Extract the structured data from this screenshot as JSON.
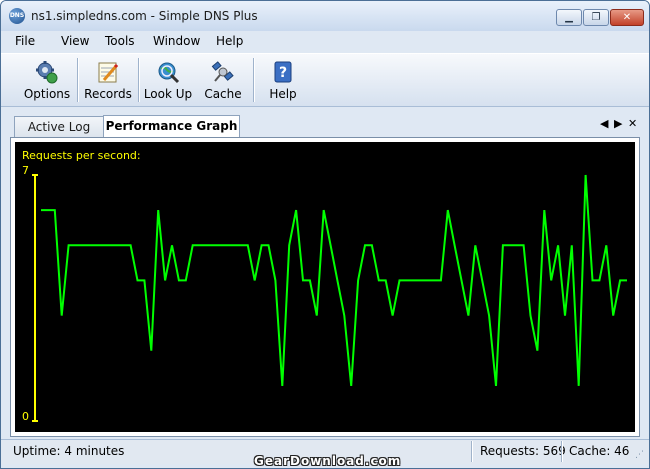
{
  "window": {
    "title": "ns1.simpledns.com - Simple DNS Plus",
    "app_icon_text": "DNS"
  },
  "title_buttons": {
    "minimize": "▁",
    "maximize": "❐",
    "close": "✕"
  },
  "menu": [
    "File",
    "View",
    "Tools",
    "Window",
    "Help"
  ],
  "toolbar": {
    "buttons": [
      {
        "label": "Options",
        "icon": "gear-globe-icon"
      },
      {
        "label": "Records",
        "icon": "notepad-pencil-icon"
      },
      {
        "label": "Look Up",
        "icon": "globe-magnifier-icon"
      },
      {
        "label": "Cache",
        "icon": "satellite-icon"
      },
      {
        "label": "Help",
        "icon": "help-book-icon"
      }
    ]
  },
  "tabs": [
    {
      "label": "Active Log",
      "active": false
    },
    {
      "label": "Performance Graph",
      "active": true
    }
  ],
  "tab_controls": {
    "prev": "◀",
    "next": "▶",
    "close": "✕"
  },
  "chart_data": {
    "type": "line",
    "title": "Requests per second:",
    "ylim": [
      0,
      7
    ],
    "yticks": [
      "7",
      "0"
    ],
    "grid": false,
    "color": "#00ff00",
    "axis_color": "#ffff00",
    "values": [
      6,
      6,
      6,
      3,
      5,
      5,
      5,
      5,
      5,
      5,
      5,
      5,
      5,
      5,
      4,
      4,
      2,
      6,
      4,
      5,
      4,
      4,
      5,
      5,
      5,
      5,
      5,
      5,
      5,
      5,
      5,
      4,
      5,
      5,
      4,
      1,
      5,
      6,
      4,
      4,
      3,
      6,
      5,
      4,
      3,
      1,
      4,
      5,
      5,
      4,
      4,
      3,
      4,
      4,
      4,
      4,
      4,
      4,
      4,
      6,
      5,
      4,
      3,
      5,
      4,
      3,
      1,
      5,
      5,
      5,
      5,
      3,
      2,
      6,
      4,
      5,
      3,
      5,
      1,
      7,
      4,
      4,
      5,
      3,
      4,
      4
    ]
  },
  "status": {
    "uptime": "Uptime: 4 minutes",
    "requests": "Requests: 569",
    "cache": "Cache: 46"
  },
  "watermark": "GearDownload.com"
}
